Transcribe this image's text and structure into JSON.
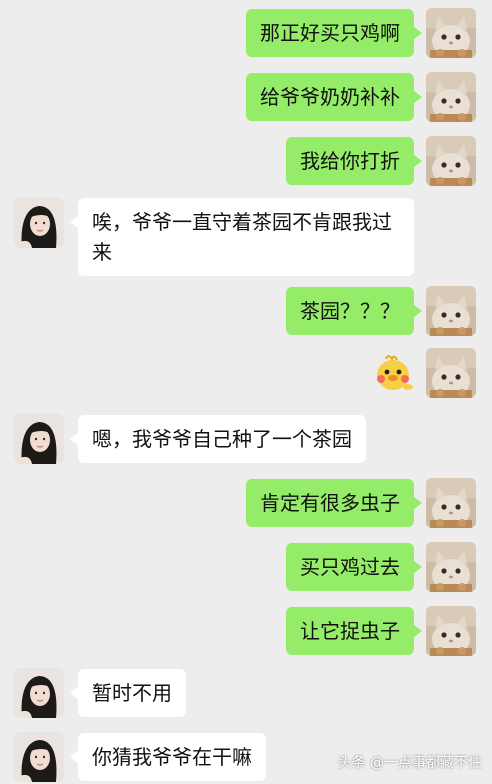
{
  "chat": {
    "messages": [
      {
        "side": "out",
        "text": "那正好买只鸡啊"
      },
      {
        "side": "out",
        "text": "给爷爷奶奶补补"
      },
      {
        "side": "out",
        "text": "我给你打折"
      },
      {
        "side": "in",
        "text": "唉，爷爷一直守着茶园不肯跟我过来"
      },
      {
        "side": "out",
        "text": "茶园？？？"
      },
      {
        "side": "out",
        "sticker": "duck-sticker"
      },
      {
        "side": "in",
        "text": "嗯，我爷爷自己种了一个茶园"
      },
      {
        "side": "out",
        "text": "肯定有很多虫子"
      },
      {
        "side": "out",
        "text": "买只鸡过去"
      },
      {
        "side": "out",
        "text": "让它捉虫子"
      },
      {
        "side": "in",
        "text": "暂时不用"
      },
      {
        "side": "in",
        "text": "你猜我爷爷在干嘛"
      }
    ]
  },
  "watermark": "头条 @一点事都藏不住",
  "icons": {
    "self_avatar": "cat-avatar-icon",
    "contact_avatar": "girl-avatar-icon",
    "sticker": "duck-sticker-icon"
  },
  "colors": {
    "background": "#ededed",
    "outgoing_bubble": "#95ec69",
    "incoming_bubble": "#ffffff"
  }
}
